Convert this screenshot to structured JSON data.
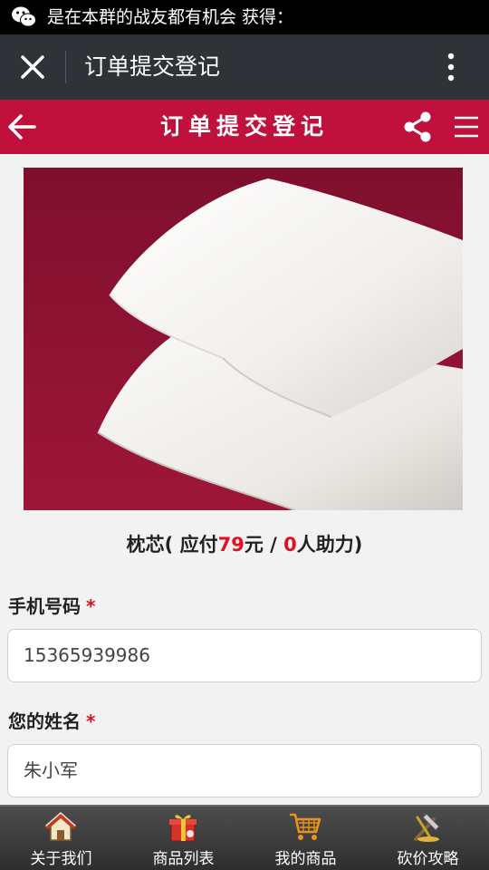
{
  "status_bar": {
    "notification": "是在本群的战友都有机会 获得："
  },
  "browser": {
    "title": "订单提交登记"
  },
  "header": {
    "title": "订单提交登记"
  },
  "product": {
    "name": "枕芯",
    "paren_open": "( 应付",
    "price": "79",
    "unit": "元 /",
    "helpers": "0",
    "helpers_suffix": "人助力)"
  },
  "form": {
    "phone": {
      "label": "手机号码",
      "required_mark": "*",
      "value": "15365939986"
    },
    "name": {
      "label": "您的姓名",
      "required_mark": "*",
      "value": "朱小军"
    }
  },
  "tabs": [
    {
      "label": "关于我们",
      "icon": "house-icon"
    },
    {
      "label": "商品列表",
      "icon": "gift-icon"
    },
    {
      "label": "我的商品",
      "icon": "cart-icon"
    },
    {
      "label": "砍价攻略",
      "icon": "hammer-icon"
    }
  ],
  "colors": {
    "accent": "#c0103c",
    "price": "#e01020",
    "topbar": "#2f3236"
  }
}
